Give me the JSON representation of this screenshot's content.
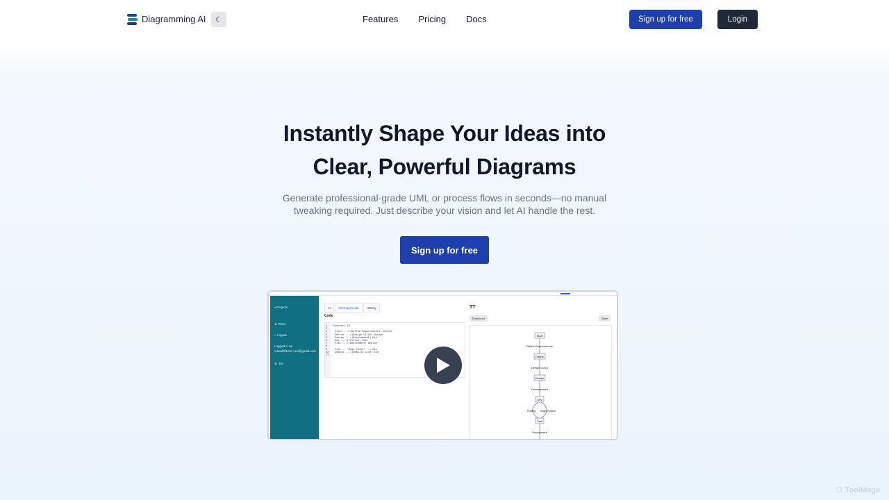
{
  "nav": {
    "brand": "Diagramming AI",
    "theme_icon": "moon-icon",
    "links": [
      "Features",
      "Pricing",
      "Docs"
    ],
    "signup_label": "Sign up for free",
    "login_label": "Login"
  },
  "hero": {
    "title_line1": "Instantly Shape Your Ideas into",
    "title_line2": "Clear, Powerful Diagrams",
    "subtitle": "Generate professional-grade UML or process flows in seconds—no manual tweaking required. Just describe your vision and let AI handle the rest.",
    "cta_label": "Sign up for free"
  },
  "preview": {
    "sidebar": {
      "projects": "Projects",
      "plans": "Plans",
      "logout": "Logout",
      "logged_in_as": "Logged in as:",
      "email": "cuwall0f12sh+ooi@gmail.com",
      "lang": "EN"
    },
    "tabs": [
      "AI",
      "Mermaid Code",
      "History"
    ],
    "code_label": "Code",
    "code_lines": [
      "flowchart TD",
      "",
      "  Start --->|Define Requirements| Define",
      "  Define --->|Design UI/UX| Design",
      "  Design --->|Development| Dev",
      "  Dev --->|Testing| Test",
      "  Test --->|Deployment| Deploy",
      "",
      "  Test -- \"Bugs Found\" --> Dev",
      "  Deploy --->|Website Live| End"
    ],
    "line_numbers": [
      "1",
      "2",
      "3",
      "4",
      "5",
      "6",
      "7",
      "8",
      "9",
      "10",
      "11"
    ],
    "diagram_title": "TT",
    "download_label": "Download",
    "save_label": "Save",
    "nodes": [
      "Start",
      "Define",
      "Design",
      "Dev",
      "Test"
    ],
    "edge_labels": [
      "Define Requirements",
      "Design UI/UX",
      "Development",
      "Testing",
      "Bugs Found",
      "Deployment"
    ]
  },
  "watermark": "ToolMage",
  "colors": {
    "primary": "#1e40af",
    "dark": "#1f2937",
    "sidebar": "#0e7080"
  }
}
